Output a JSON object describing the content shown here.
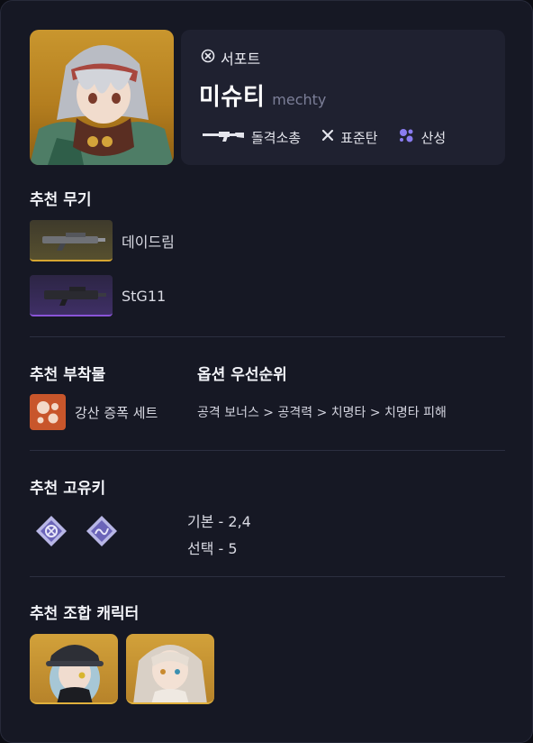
{
  "character": {
    "role": "서포트",
    "name_ko": "미슈티",
    "name_en": "mechty",
    "tags": [
      {
        "label": "돌격소총",
        "icon": "rifle-icon"
      },
      {
        "label": "표준탄",
        "icon": "standard-ammo-icon"
      },
      {
        "label": "산성",
        "icon": "acid-element-icon"
      }
    ]
  },
  "sections": {
    "weapons_title": "추천 무기",
    "attachments_title": "추천 부착물",
    "priority_title": "옵션 우선순위",
    "keys_title": "추천 고유키",
    "combo_title": "추천 조합 캐릭터"
  },
  "weapons": [
    {
      "name": "데이드림",
      "rarity": "gold"
    },
    {
      "name": "StG11",
      "rarity": "purple"
    }
  ],
  "attachment": {
    "name": "강산 증폭 세트"
  },
  "priority": "공격 보너스 > 공격력 > 치명타 > 치명타 피해",
  "keys": {
    "basic": "기본 - 2,4",
    "choice": "선택 - 5"
  },
  "colors": {
    "card_bg": "#161824",
    "panel_bg": "#1f2130",
    "gold": "#d6a631",
    "purple": "#8a54d8",
    "acid": "#8a7cf0",
    "attachment": "#c8562b"
  }
}
